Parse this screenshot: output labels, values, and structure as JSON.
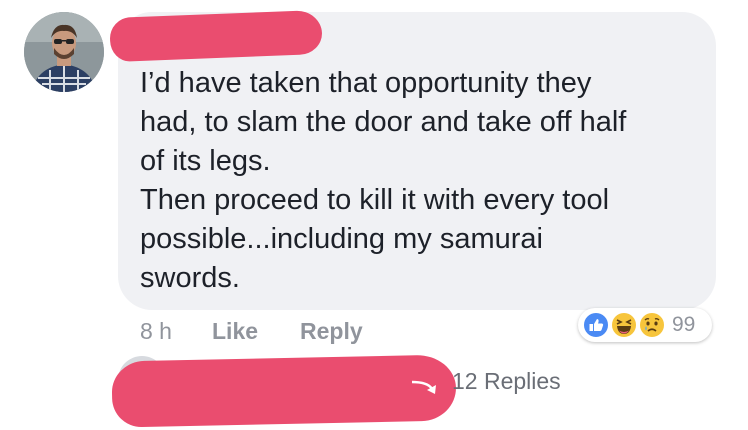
{
  "comment": {
    "text": "I’d have taken that opportunity they\nhad, to slam the door and take off half\nof its legs.\nThen proceed to kill it with every tool\npossible...including my samurai\nswords.",
    "timestamp": "8 h",
    "like_label": "Like",
    "reply_label": "Reply"
  },
  "reactions": {
    "icons": [
      "like-icon",
      "haha-icon",
      "sad-icon"
    ],
    "count": "99"
  },
  "replies": {
    "count_label": "12 Replies"
  },
  "colors": {
    "bubble": "#f0f1f4",
    "redaction": "#ea4d6f",
    "like_blue": "#4a8af4",
    "reaction_yellow": "#f7c53c",
    "meta_gray": "#90949c",
    "text": "#1d2129"
  }
}
